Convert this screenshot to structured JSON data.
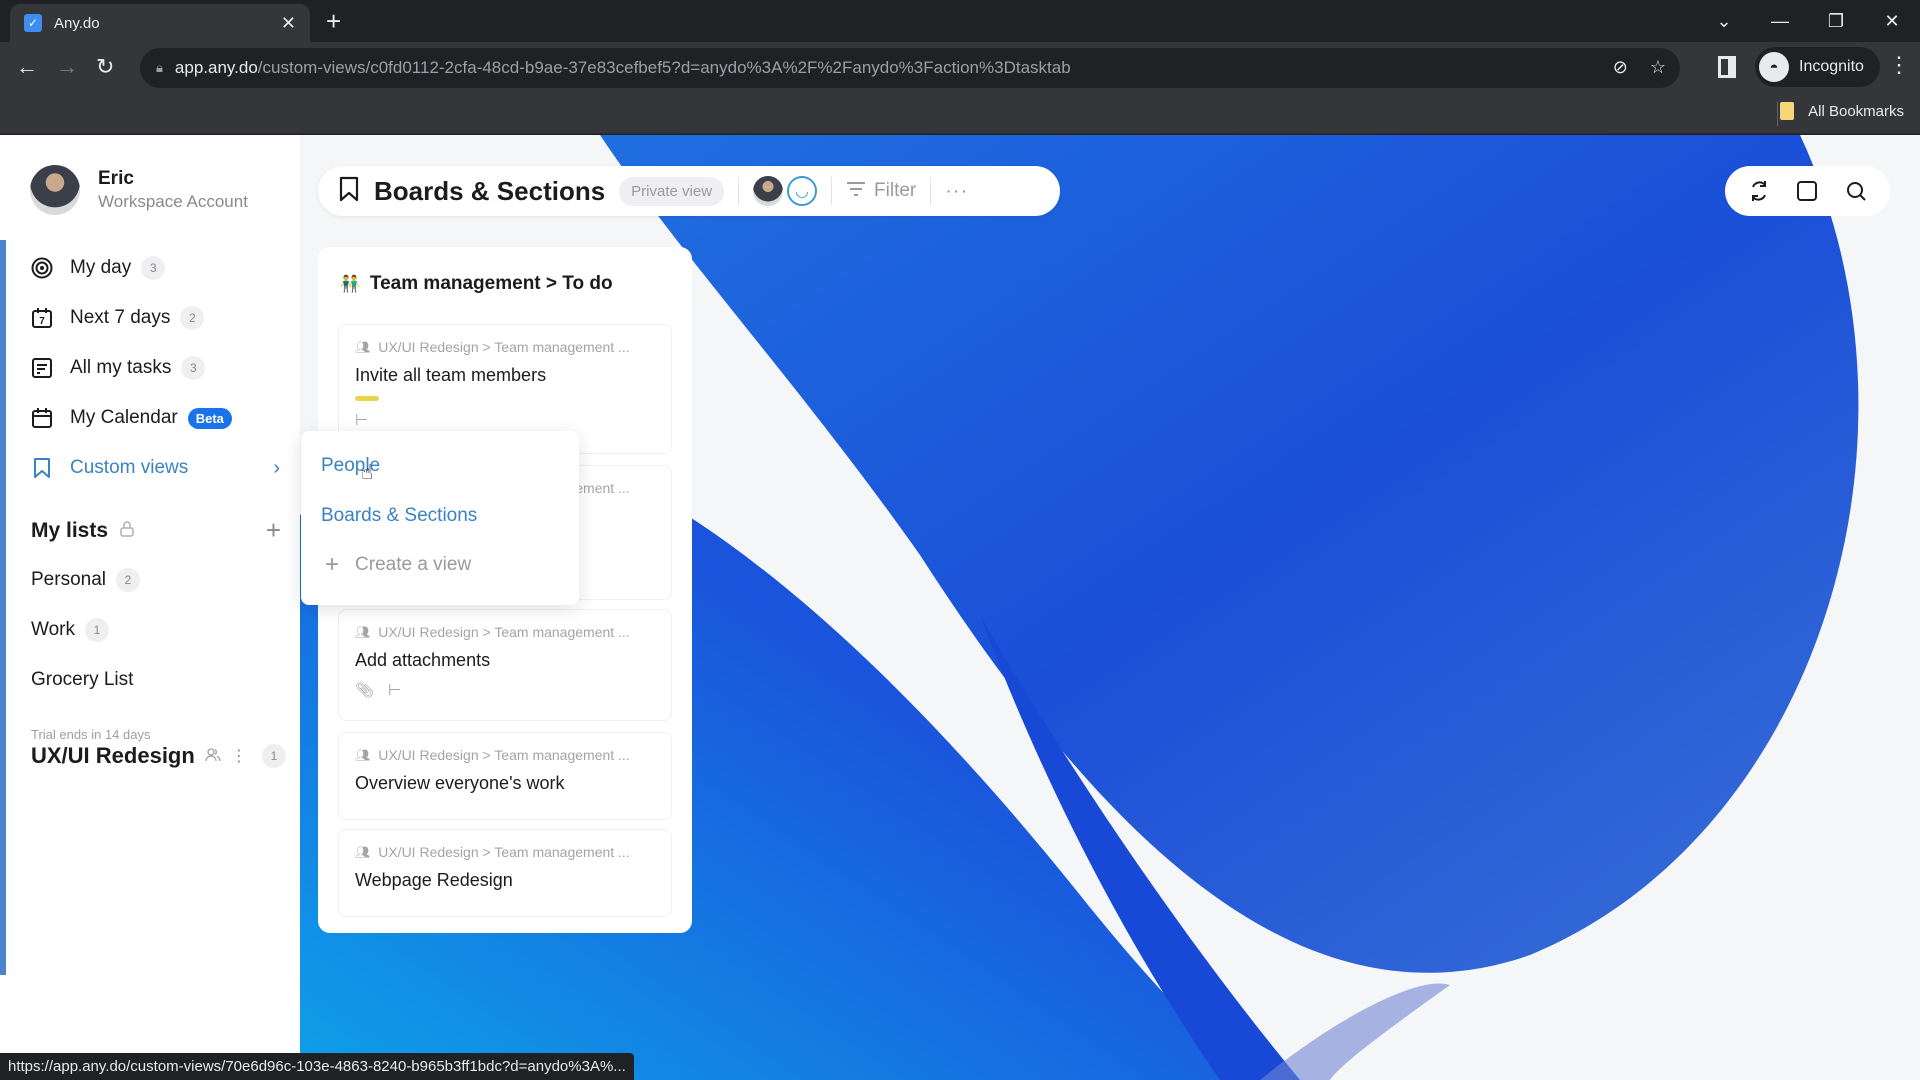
{
  "browser": {
    "tab_title": "Any.do",
    "url_host": "app.any.do",
    "url_path": "/custom-views/c0fd0112-2cfa-48cd-b9ae-37e83cefbef5?d=anydo%3A%2F%2Fanydo%3Faction%3Dtasktab",
    "profile_label": "Incognito",
    "bookmarks_label": "All Bookmarks",
    "status_url": "https://app.any.do/custom-views/70e6d96c-103e-4863-8240-b965b3ff1bdc?d=anydo%3A%..."
  },
  "user": {
    "name": "Eric",
    "account_type": "Workspace Account"
  },
  "sidebar": {
    "nav": [
      {
        "label": "My day",
        "count": "3",
        "icon": "target-icon"
      },
      {
        "label": "Next 7 days",
        "count": "2",
        "icon": "calendar-7-icon"
      },
      {
        "label": "All my tasks",
        "count": "3",
        "icon": "list-icon"
      },
      {
        "label": "My Calendar",
        "badge": "Beta",
        "icon": "calendar-icon"
      },
      {
        "label": "Custom views",
        "icon": "bookmark-icon"
      }
    ],
    "my_lists_title": "My lists",
    "lists": [
      {
        "label": "Personal",
        "count": "2"
      },
      {
        "label": "Work",
        "count": "1"
      },
      {
        "label": "Grocery List"
      }
    ],
    "trial_text": "Trial ends in 14 days",
    "workspace_name": "UX/UI Redesign",
    "workspace_count": "1"
  },
  "header": {
    "title": "Boards & Sections",
    "private_label": "Private view",
    "filter_label": "Filter",
    "more_label": "···"
  },
  "board": {
    "title": "Team management > To do",
    "cards": [
      {
        "crumb": "UX/UI Redesign > Team management ...",
        "title": "Invite all team members"
      },
      {
        "crumb": "UX/UI Redesign > Team management ...",
        "title": ""
      },
      {
        "crumb": "UX/UI Redesign > Team management ...",
        "title": "Add attachments"
      },
      {
        "crumb": "UX/UI Redesign > Team management ...",
        "title": "Overview everyone's work"
      },
      {
        "crumb": "UX/UI Redesign > Team management ...",
        "title": "Webpage Redesign"
      }
    ],
    "hidden_crumb_tail": "ement ..."
  },
  "dropdown": {
    "items": [
      "People",
      "Boards & Sections"
    ],
    "create_label": "Create a view"
  },
  "colors": {
    "accent": "#3b82c4",
    "beta": "#1a73e8",
    "tag_yellow": "#e8d44d"
  }
}
